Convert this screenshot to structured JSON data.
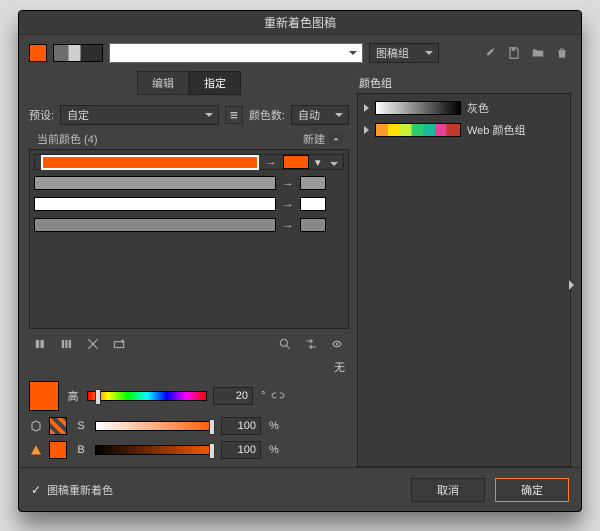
{
  "title": "重新着色图稿",
  "top": {
    "group_selector": "图稿组"
  },
  "tabs": {
    "edit": "编辑",
    "assign": "指定"
  },
  "preset_row": {
    "label": "预设:",
    "value": "自定",
    "count_label": "颜色数:",
    "count_value": "自动"
  },
  "list": {
    "header": "当前颜色 (4)",
    "new": "新建"
  },
  "right": {
    "title": "颜色组",
    "items": [
      {
        "label": "灰色"
      },
      {
        "label": "Web 颜色组"
      }
    ]
  },
  "none_label": "无",
  "hsb": {
    "h_label": "高",
    "h_value": "20",
    "h_unit": "°",
    "s_label": "S",
    "s_value": "100",
    "s_unit": "%",
    "b_label": "B",
    "b_value": "100",
    "b_unit": "%",
    "hue_thumb_pct": 6,
    "sat_thumb_pct": 96,
    "bri_thumb_pct": 96
  },
  "footer": {
    "checkbox": "图稿重新着色",
    "cancel": "取消",
    "ok": "确定"
  },
  "chart_data": {
    "type": "table",
    "title": "当前颜色 (4)",
    "columns": [
      "current_color",
      "target_color"
    ],
    "rows": [
      {
        "current_color": "#ff5a00",
        "target_color": "#ff5a00"
      },
      {
        "current_color": "#9a9a9a",
        "target_color": "#9a9a9a"
      },
      {
        "current_color": "#ffffff",
        "target_color": "#ffffff"
      },
      {
        "current_color": "#888888",
        "target_color": "#888888"
      }
    ]
  }
}
